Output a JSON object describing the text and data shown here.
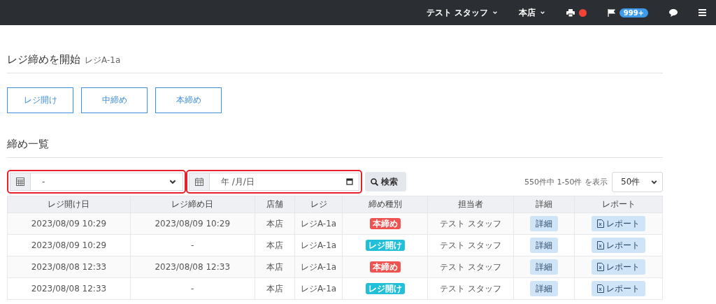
{
  "navbar": {
    "user": "テスト スタッフ",
    "store": "本店",
    "printer_alert": true,
    "notifications": "999+"
  },
  "page": {
    "title": "レジ締めを開始",
    "subtitle": "レジA-1a"
  },
  "actions": [
    "レジ開け",
    "中締め",
    "本締め"
  ],
  "list": {
    "title": "締め一覧",
    "filters": [
      {
        "kind": "select",
        "value": "-",
        "highlighted": true
      },
      {
        "kind": "date",
        "value": "年 /月/日",
        "highlighted": true
      }
    ],
    "search_button": "検索",
    "summary": "550件中 1-50件 を表示",
    "per_page": "50件",
    "columns": [
      "レジ開け日",
      "レジ締め日",
      "店舗",
      "レジ",
      "締め種別",
      "担当者",
      "詳細",
      "レポート"
    ],
    "rows": [
      {
        "opened": "2023/08/09 10:29",
        "closed": "2023/08/09 10:29",
        "store": "本店",
        "register": "レジA-1a",
        "type": {
          "label": "本締め",
          "color": "#ef5350"
        },
        "staff": "テスト スタッフ",
        "detail": "詳細",
        "report": "レポート"
      },
      {
        "opened": "2023/08/09 10:29",
        "closed": "-",
        "store": "本店",
        "register": "レジA-1a",
        "type": {
          "label": "レジ開け",
          "color": "#22c0d8"
        },
        "staff": "テスト スタッフ",
        "detail": "詳細",
        "report": "レポート"
      },
      {
        "opened": "2023/08/08 12:33",
        "closed": "2023/08/08 12:33",
        "store": "本店",
        "register": "レジA-1a",
        "type": {
          "label": "本締め",
          "color": "#ef5350"
        },
        "staff": "テスト スタッフ",
        "detail": "詳細",
        "report": "レポート"
      },
      {
        "opened": "2023/08/08 12:33",
        "closed": "-",
        "store": "本店",
        "register": "レジA-1a",
        "type": {
          "label": "レジ開け",
          "color": "#22c0d8"
        },
        "staff": "テスト スタッフ",
        "detail": "詳細",
        "report": "レポート"
      }
    ]
  }
}
